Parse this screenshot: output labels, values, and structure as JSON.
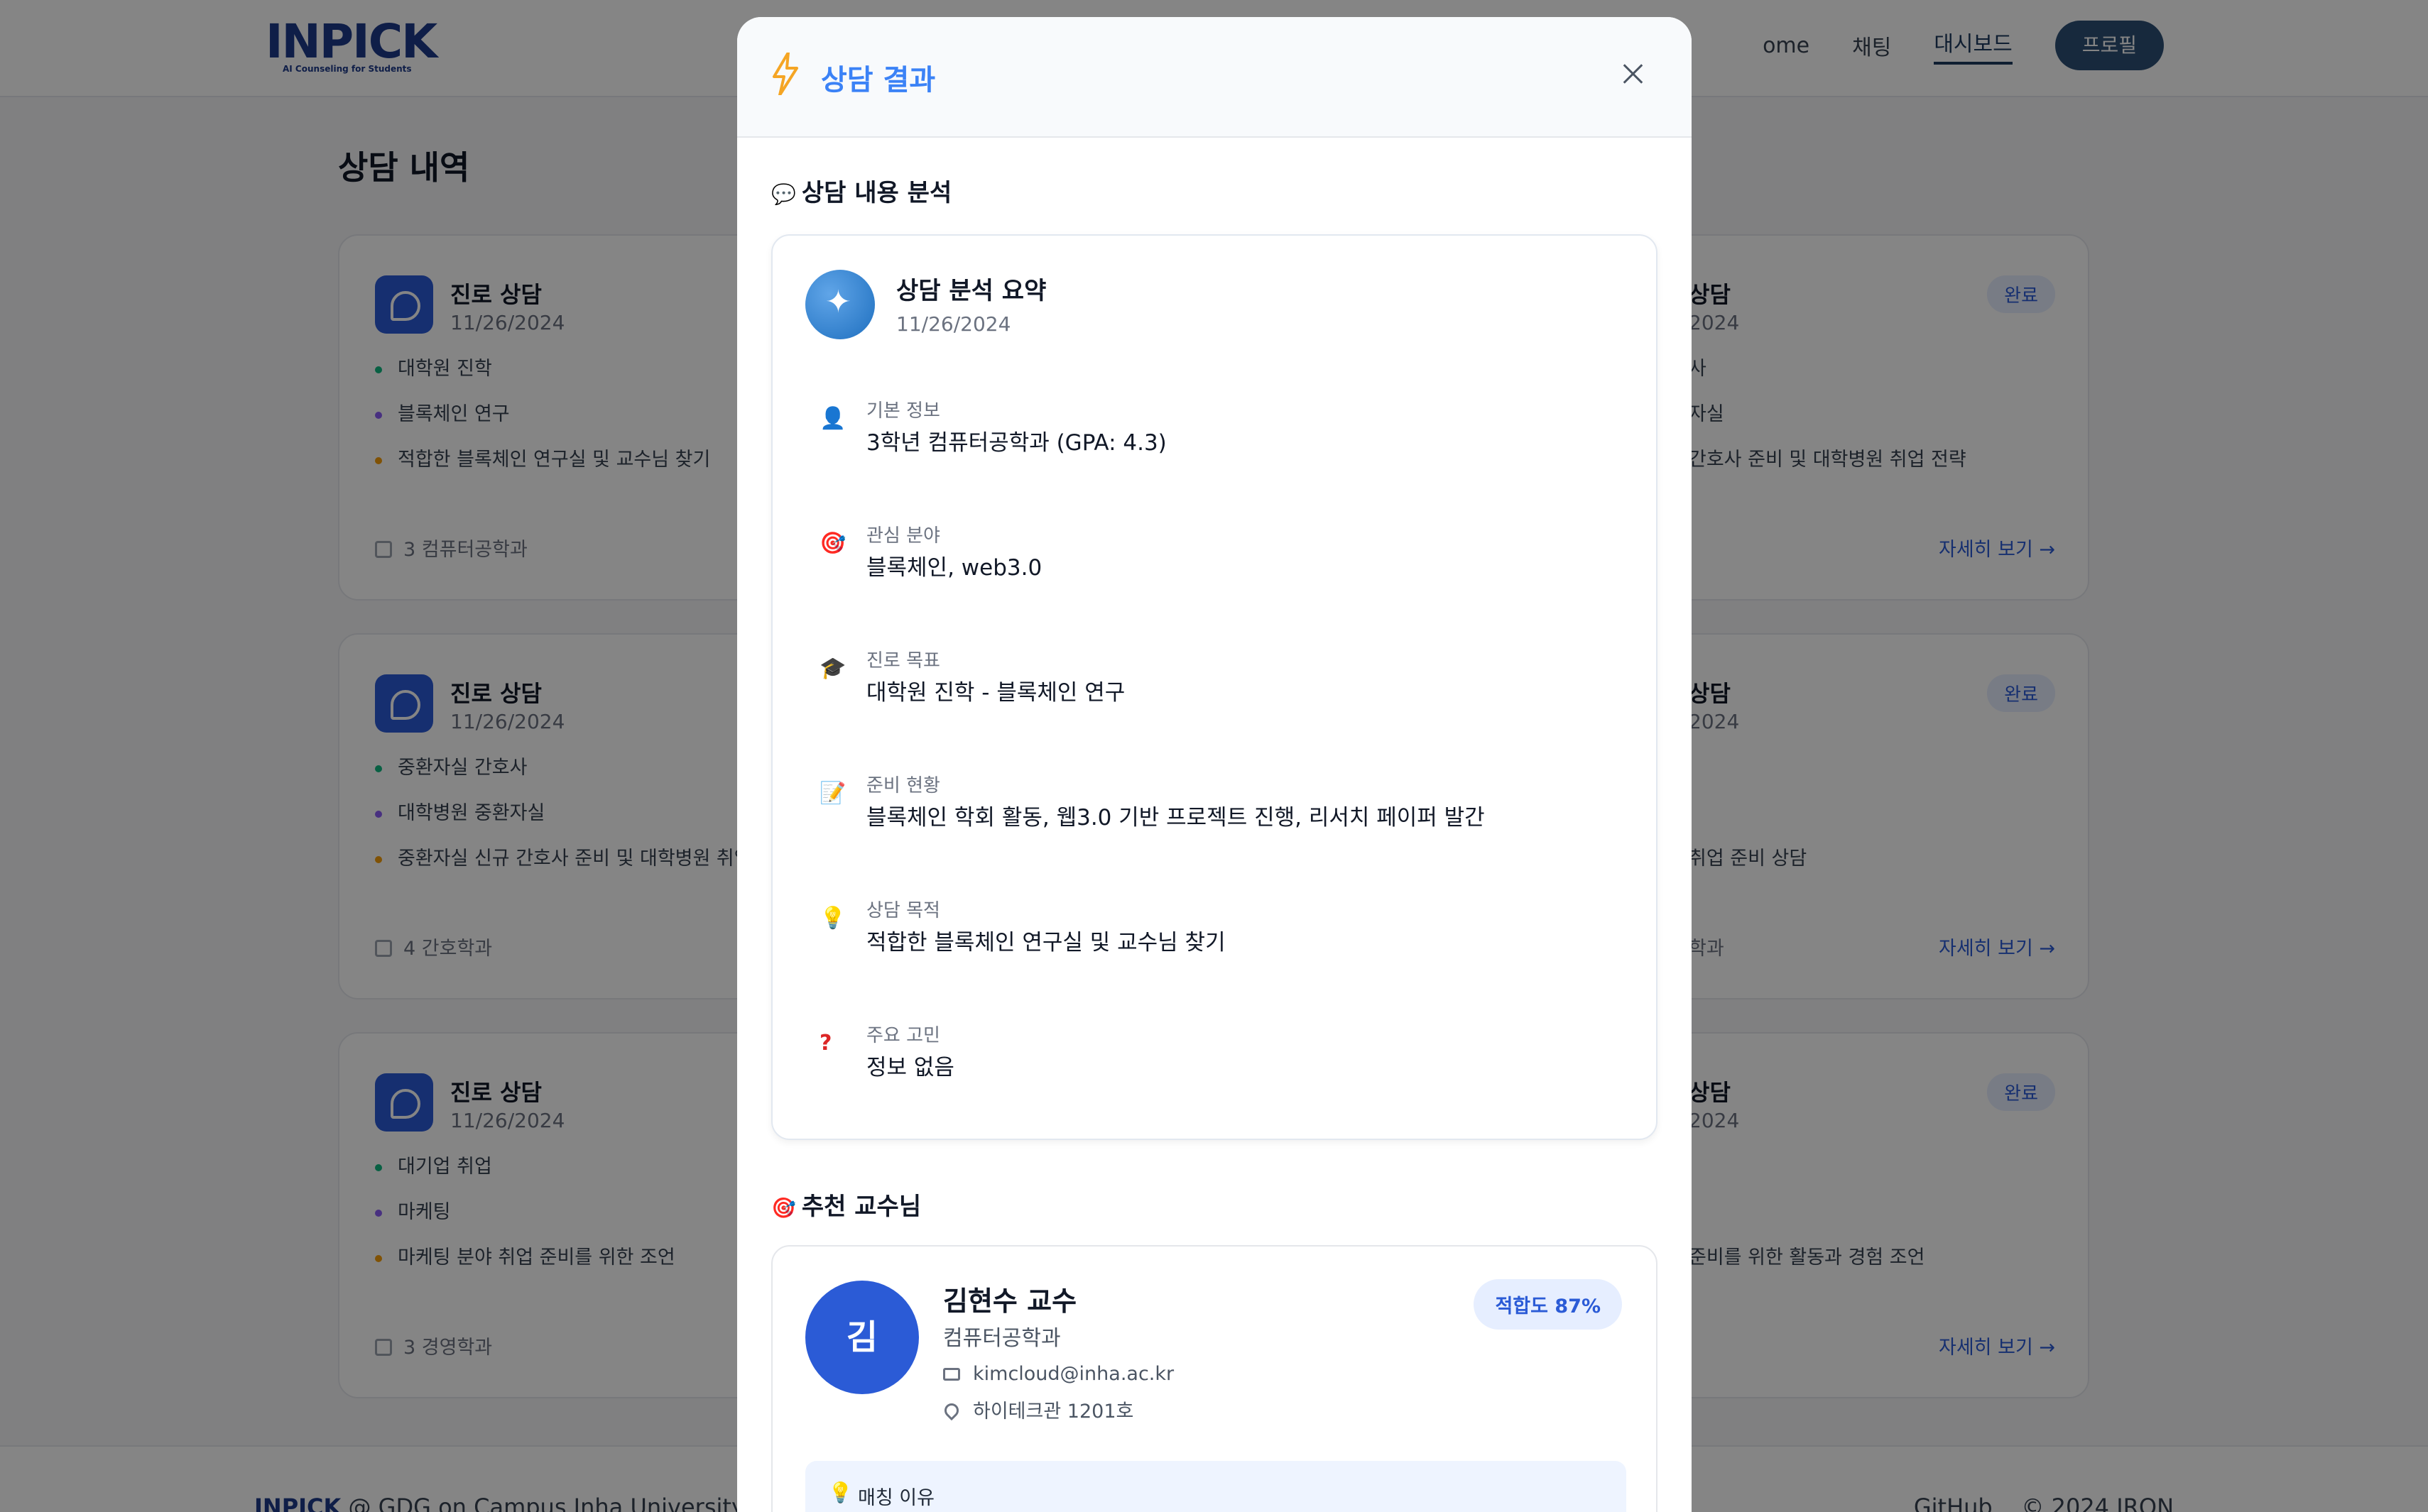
{
  "brand": {
    "logo": "INPICK",
    "tagline": "AI Counseling for Students"
  },
  "nav": {
    "home": "ome",
    "chat": "채팅",
    "dashboard": "대시보드",
    "profile": "프로필"
  },
  "page": {
    "title": "상담 내역"
  },
  "cards_left": [
    {
      "title": "진로 상담",
      "date": "11/26/2024",
      "items": [
        "대학원 진학",
        "블록체인 연구",
        "적합한 블록체인 연구실 및 교수님 찾기"
      ],
      "footer": "3 컴퓨터공학과"
    },
    {
      "title": "진로 상담",
      "date": "11/26/2024",
      "items": [
        "중환자실 간호사",
        "대학병원 중환자실",
        "중환자실 신규 간호사 준비 및 대학병원 취업"
      ],
      "footer": "4 간호학과"
    },
    {
      "title": "진로 상담",
      "date": "11/26/2024",
      "items": [
        "대기업 취업",
        "마케팅",
        "마케팅 분야 취업 준비를 위한 조언"
      ],
      "footer": "3 경영학과"
    }
  ],
  "cards_right": [
    {
      "title": "상담",
      "date": "2024",
      "items": [
        "사",
        "자실",
        "간호사 준비 및 대학병원 취업 전략"
      ],
      "footer": "",
      "badge": "완료",
      "more": "자세히 보기 →"
    },
    {
      "title": "상담",
      "date": "2024",
      "items": [
        "",
        "",
        "취업 준비 상담"
      ],
      "footer": "학과",
      "badge": "완료",
      "more": "자세히 보기 →"
    },
    {
      "title": "상담",
      "date": "2024",
      "items": [
        "",
        "",
        "준비를 위한 활동과 경험 조언"
      ],
      "footer": "",
      "badge": "완료",
      "more": "자세히 보기 →"
    }
  ],
  "footer": {
    "brand": "INPICK",
    "left_text": "@ GDG on Campus Inha University",
    "github": "GitHub",
    "copyright": "© 2024 IRON"
  },
  "modal": {
    "title": "상담 결과",
    "analysis_section": "상담 내용 분석",
    "summary": {
      "title": "상담 분석 요약",
      "date": "11/26/2024",
      "rows": [
        {
          "icon": "person-icon",
          "label": "기본 정보",
          "value": "3학년 컴퓨터공학과 (GPA: 4.3)"
        },
        {
          "icon": "target-icon",
          "label": "관심 분야",
          "value": "블록체인, web3.0"
        },
        {
          "icon": "graduation-cap-icon",
          "label": "진로 목표",
          "value": "대학원 진학 - 블록체인 연구"
        },
        {
          "icon": "memo-icon",
          "label": "준비 현황",
          "value": "블록체인 학회 활동, 웹3.0 기반 프로젝트 진행, 리서치 페이퍼 발간"
        },
        {
          "icon": "lightbulb-icon",
          "label": "상담 목적",
          "value": "적합한 블록체인 연구실 및 교수님 찾기"
        },
        {
          "icon": "question-icon",
          "label": "주요 고민",
          "value": "정보 없음"
        }
      ]
    },
    "recommend_section": "추천 교수님",
    "professor": {
      "avatar": "김",
      "name": "김현수 교수",
      "dept": "컴퓨터공학과",
      "email": "kimcloud@inha.ac.kr",
      "office": "하이테크관 1201호",
      "match": "적합도 87%",
      "reason_label": "매칭 이유"
    }
  },
  "colors": {
    "accent": "#2b5bd6",
    "title_blue": "#3b82f6",
    "nav_profile": "#2c4f75",
    "dot_green": "#10b981",
    "dot_purple": "#8b5cf6",
    "dot_orange": "#f59e0b"
  }
}
